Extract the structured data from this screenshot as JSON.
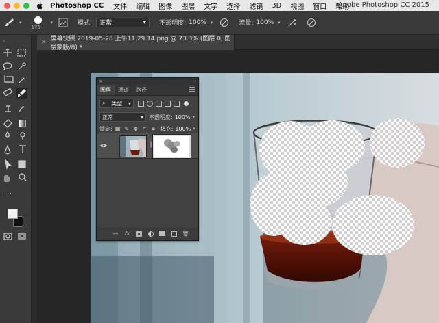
{
  "menubar": {
    "app_name": "Photoshop CC",
    "menus": [
      "文件",
      "编辑",
      "图像",
      "图层",
      "文字",
      "选择",
      "滤镜",
      "3D",
      "视图",
      "窗口",
      "帮助"
    ],
    "window_title": "Adobe Photoshop CC 2015"
  },
  "options": {
    "brush_size": "175",
    "mode_label": "模式:",
    "mode_value": "正常",
    "opacity_label": "不透明度:",
    "opacity_value": "100%",
    "flow_label": "流量:",
    "flow_value": "100%"
  },
  "document": {
    "tab_title": "屏幕快照 2019-05-28 上午11.29.14.png @ 73.3% (图层 0, 图层蒙版/8) *"
  },
  "colors": {
    "foreground": "#f2f2f2",
    "background": "#111111"
  },
  "layers_panel": {
    "tabs": [
      "图层",
      "通道",
      "路径"
    ],
    "filter_kind": "类型",
    "blend_mode": "正常",
    "opacity_label": "不透明度:",
    "opacity_value": "100%",
    "lock_label": "锁定:",
    "fill_label": "填充:",
    "fill_value": "100%"
  }
}
